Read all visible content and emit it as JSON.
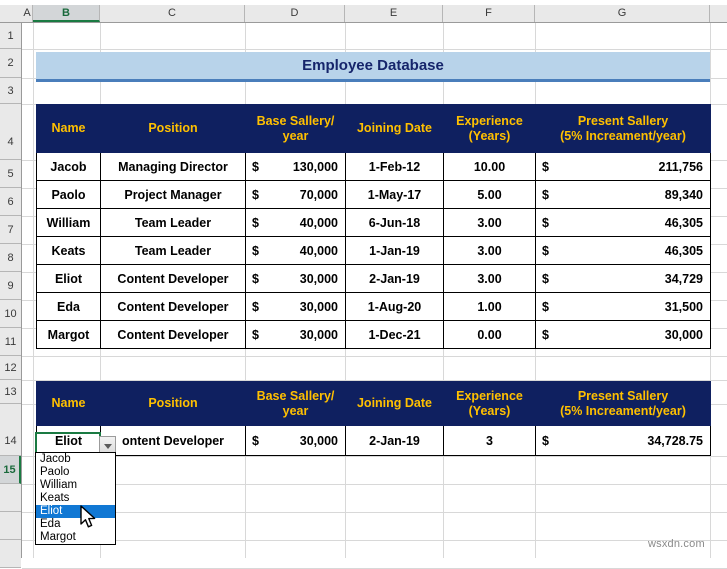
{
  "spreadsheet": {
    "column_headers": [
      "A",
      "B",
      "C",
      "D",
      "E",
      "F",
      "G"
    ],
    "selected_column": "B",
    "row_headers": [
      "1",
      "2",
      "3",
      "4",
      "5",
      "6",
      "7",
      "8",
      "9",
      "10",
      "11",
      "12",
      "13",
      "14",
      "15"
    ],
    "selected_row": "15",
    "active_cell": "B15"
  },
  "title": {
    "text": "Employee Database"
  },
  "table1": {
    "headers": [
      {
        "line1": "Name",
        "line2": ""
      },
      {
        "line1": "Position",
        "line2": ""
      },
      {
        "line1": "Base Sallery/",
        "line2": "year"
      },
      {
        "line1": "Joining Date",
        "line2": ""
      },
      {
        "line1": "Experience",
        "line2": "(Years)"
      },
      {
        "line1": "Present Sallery",
        "line2": "(5% Increament/year)"
      }
    ],
    "rows": [
      {
        "name": "Jacob",
        "position": "Managing Director",
        "base_sym": "$",
        "base": "130,000",
        "joining": "1-Feb-12",
        "experience": "10.00",
        "present_sym": "$",
        "present": "211,756"
      },
      {
        "name": "Paolo",
        "position": "Project Manager",
        "base_sym": "$",
        "base": "70,000",
        "joining": "1-May-17",
        "experience": "5.00",
        "present_sym": "$",
        "present": "89,340"
      },
      {
        "name": "William",
        "position": "Team Leader",
        "base_sym": "$",
        "base": "40,000",
        "joining": "6-Jun-18",
        "experience": "3.00",
        "present_sym": "$",
        "present": "46,305"
      },
      {
        "name": "Keats",
        "position": "Team Leader",
        "base_sym": "$",
        "base": "40,000",
        "joining": "1-Jan-19",
        "experience": "3.00",
        "present_sym": "$",
        "present": "46,305"
      },
      {
        "name": "Eliot",
        "position": "Content Developer",
        "base_sym": "$",
        "base": "30,000",
        "joining": "2-Jan-19",
        "experience": "3.00",
        "present_sym": "$",
        "present": "34,729"
      },
      {
        "name": "Eda",
        "position": "Content Developer",
        "base_sym": "$",
        "base": "30,000",
        "joining": "1-Aug-20",
        "experience": "1.00",
        "present_sym": "$",
        "present": "31,500"
      },
      {
        "name": "Margot",
        "position": "Content Developer",
        "base_sym": "$",
        "base": "30,000",
        "joining": "1-Dec-21",
        "experience": "0.00",
        "present_sym": "$",
        "present": "30,000"
      }
    ]
  },
  "table2": {
    "headers": [
      {
        "line1": "Name",
        "line2": ""
      },
      {
        "line1": "Position",
        "line2": ""
      },
      {
        "line1": "Base Sallery/",
        "line2": "year"
      },
      {
        "line1": "Joining Date",
        "line2": ""
      },
      {
        "line1": "Experience",
        "line2": "(Years)"
      },
      {
        "line1": "Present Sallery",
        "line2": "(5% Increament/year)"
      }
    ],
    "rows": [
      {
        "name": "Eliot",
        "position": "ontent Developer",
        "base_sym": "$",
        "base": "30,000",
        "joining": "2-Jan-19",
        "experience": "3",
        "present_sym": "$",
        "present": "34,728.75"
      }
    ]
  },
  "dropdown": {
    "open": true,
    "selected": "Eliot",
    "options": [
      "Jacob",
      "Paolo",
      "William",
      "Keats",
      "Eliot",
      "Eda",
      "Margot"
    ]
  },
  "watermark": {
    "text": "wsxdn.com"
  },
  "colors": {
    "header_navy": "#0f2060",
    "header_gold": "#ffc000",
    "title_fill": "#b8d3ea",
    "title_text": "#16256b",
    "title_rule": "#4a7ebb",
    "selection_green": "#1a7a42",
    "dropdown_highlight": "#1178d4"
  }
}
